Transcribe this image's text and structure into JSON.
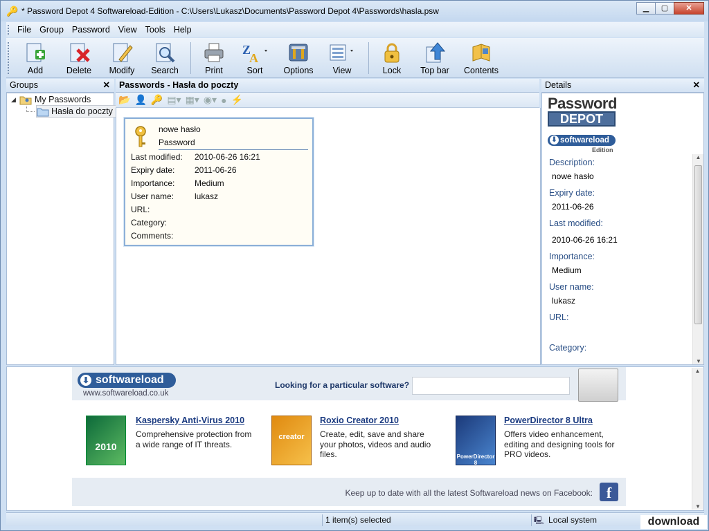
{
  "window": {
    "title": "* Password Depot 4 Softwareload-Edition - C:\\Users\\Lukasz\\Documents\\Password Depot 4\\Passwords\\hasla.psw"
  },
  "menu": [
    "File",
    "Group",
    "Password",
    "View",
    "Tools",
    "Help"
  ],
  "toolbar": {
    "add": "Add",
    "delete": "Delete",
    "modify": "Modify",
    "search": "Search",
    "print": "Print",
    "sort": "Sort",
    "options": "Options",
    "view": "View",
    "lock": "Lock",
    "topbar": "Top bar",
    "contents": "Contents"
  },
  "groups": {
    "header": "Groups",
    "close": "✕",
    "root": "My Passwords",
    "child": "Hasła do poczty"
  },
  "passwords": {
    "header": "Passwords - Hasła do poczty",
    "card": {
      "name": "nowe hasło",
      "type": "Password",
      "rows": [
        {
          "k": "Last modified:",
          "v": "2010-06-26 16:21"
        },
        {
          "k": "Expiry date:",
          "v": "2011-06-26"
        },
        {
          "k": "Importance:",
          "v": "Medium"
        },
        {
          "k": "User name:",
          "v": "lukasz"
        },
        {
          "k": "URL:",
          "v": ""
        },
        {
          "k": "Category:",
          "v": ""
        },
        {
          "k": "Comments:",
          "v": ""
        }
      ]
    }
  },
  "details": {
    "header": "Details",
    "close": "✕",
    "logo_line1": "Password",
    "logo_line2": "DEPOT",
    "badge": "softwareload",
    "edition": "Edition",
    "fields": [
      {
        "label": "Description:",
        "value": "nowe hasło"
      },
      {
        "label": "Expiry date:",
        "value": "2011-06-26"
      },
      {
        "label": "Last modified:",
        "value": "2010-06-26 16:21"
      },
      {
        "label": "Importance:",
        "value": "Medium"
      },
      {
        "label": "User name:",
        "value": "lukasz"
      },
      {
        "label": "URL:",
        "value": ""
      },
      {
        "label": "Category:",
        "value": ""
      }
    ]
  },
  "ad": {
    "logo": "softwareload",
    "url": "www.softwareload.co.uk",
    "search_prompt": "Looking for a particular software?",
    "search_value": "",
    "products": [
      {
        "title": "Kaspersky Anti-Virus 2010",
        "desc": "Comprehensive protection from a wide range of IT threats.",
        "box": "2010"
      },
      {
        "title": "Roxio Creator 2010",
        "desc": "Create, edit, save and share your photos, videos and audio files.",
        "box": "creator"
      },
      {
        "title": "PowerDirector 8 Ultra",
        "desc": "Offers video enhancement, editing and designing tools for PRO videos.",
        "box": "PowerDirector 8"
      }
    ],
    "facebook_text": "Keep up to date with all the latest Softwareload news on Facebook:"
  },
  "status": {
    "selected": "1 item(s) selected",
    "location": "Local system"
  },
  "watermark": "download",
  "colors": {
    "accent": "#2a4f86",
    "link": "#1a3a80",
    "card_border": "#8cb0d8"
  }
}
